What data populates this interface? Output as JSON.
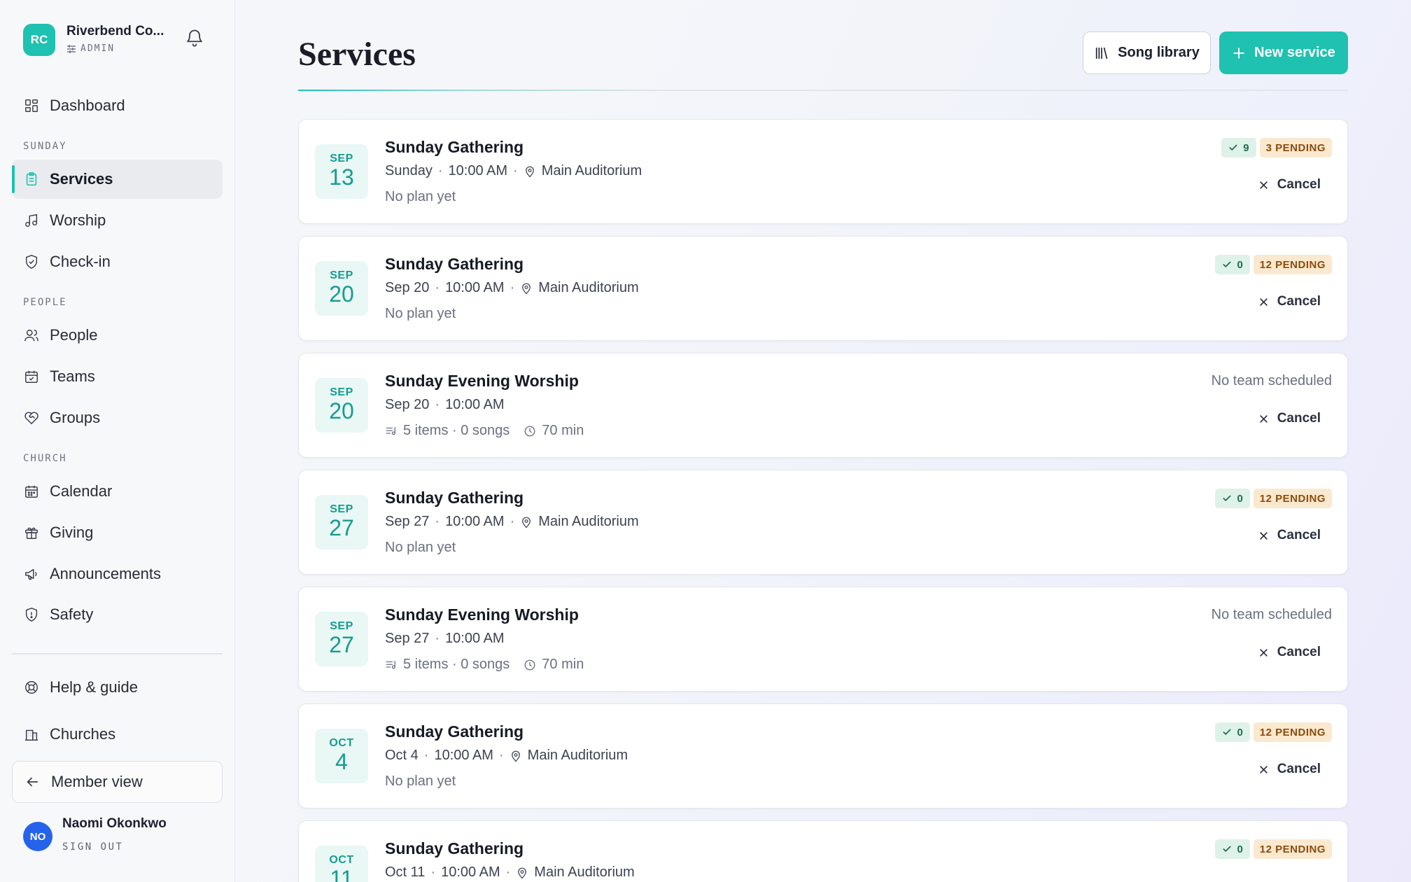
{
  "org": {
    "initials": "RC",
    "name": "Riverbend Co...",
    "role": "ADMIN"
  },
  "sidebar": {
    "dashboard": "Dashboard",
    "section_sunday": "SUNDAY",
    "services": "Services",
    "worship": "Worship",
    "checkin": "Check-in",
    "section_people": "PEOPLE",
    "people": "People",
    "teams": "Teams",
    "groups": "Groups",
    "section_church": "CHURCH",
    "calendar": "Calendar",
    "giving": "Giving",
    "announcements": "Announcements",
    "safety": "Safety",
    "help": "Help & guide",
    "churches": "Churches",
    "member_view": "Member view"
  },
  "user": {
    "initials": "NO",
    "name": "Naomi Okonkwo",
    "signout": "SIGN OUT"
  },
  "page": {
    "title": "Services",
    "song_library": "Song library",
    "new_service": "New service"
  },
  "accent": "#1fc1b1",
  "services": [
    {
      "mon": "SEP",
      "day": "13",
      "title": "Sunday Gathering",
      "when": "Sunday",
      "time": "10:00 AM",
      "location": "Main Auditorium",
      "sub": "No plan yet",
      "confirmed": "9",
      "pending": "3 PENDING",
      "cancel": "Cancel"
    },
    {
      "mon": "SEP",
      "day": "20",
      "title": "Sunday Gathering",
      "when": "Sep 20",
      "time": "10:00 AM",
      "location": "Main Auditorium",
      "sub": "No plan yet",
      "confirmed": "0",
      "pending": "12 PENDING",
      "cancel": "Cancel"
    },
    {
      "mon": "SEP",
      "day": "20",
      "title": "Sunday Evening Worship",
      "when": "Sep 20",
      "time": "10:00 AM",
      "items": "5 items · 0 songs",
      "duration": "70 min",
      "status": "No team scheduled",
      "cancel": "Cancel"
    },
    {
      "mon": "SEP",
      "day": "27",
      "title": "Sunday Gathering",
      "when": "Sep 27",
      "time": "10:00 AM",
      "location": "Main Auditorium",
      "sub": "No plan yet",
      "confirmed": "0",
      "pending": "12 PENDING",
      "cancel": "Cancel"
    },
    {
      "mon": "SEP",
      "day": "27",
      "title": "Sunday Evening Worship",
      "when": "Sep 27",
      "time": "10:00 AM",
      "items": "5 items · 0 songs",
      "duration": "70 min",
      "status": "No team scheduled",
      "cancel": "Cancel"
    },
    {
      "mon": "OCT",
      "day": "4",
      "title": "Sunday Gathering",
      "when": "Oct 4",
      "time": "10:00 AM",
      "location": "Main Auditorium",
      "sub": "No plan yet",
      "confirmed": "0",
      "pending": "12 PENDING",
      "cancel": "Cancel"
    },
    {
      "mon": "OCT",
      "day": "11",
      "title": "Sunday Gathering",
      "when": "Oct 11",
      "time": "10:00 AM",
      "location": "Main Auditorium",
      "confirmed": "0",
      "pending": "12 PENDING"
    }
  ]
}
